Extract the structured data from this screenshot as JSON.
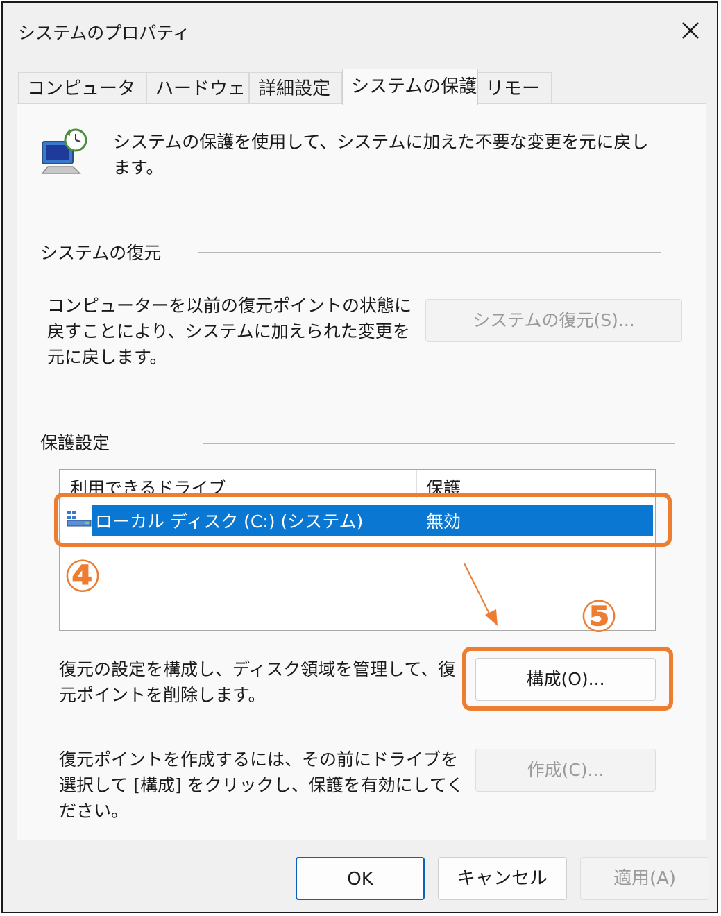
{
  "window": {
    "title": "システムのプロパティ"
  },
  "tabs": [
    {
      "label": "コンピューター名"
    },
    {
      "label": "ハードウェア"
    },
    {
      "label": "詳細設定"
    },
    {
      "label": "システムの保護"
    },
    {
      "label": "リモート"
    }
  ],
  "intro": {
    "text": "システムの保護を使用して、システムに加えた不要な変更を元に戻します。"
  },
  "restore": {
    "group_title": "システムの復元",
    "description": "コンピューターを以前の復元ポイントの状態に戻すことにより、システムに加えられた変更を元に戻します。",
    "button_label": "システムの復元(S)..."
  },
  "protection": {
    "group_title": "保護設定",
    "columns": [
      "利用できるドライブ",
      "保護"
    ],
    "drives": [
      {
        "name": "ローカル ディスク (C:) (システム)",
        "status": "無効"
      }
    ],
    "configure_description": "復元の設定を構成し、ディスク領域を管理して、復元ポイントを削除します。",
    "configure_button": "構成(O)...",
    "create_description": "復元ポイントを作成するには、その前にドライブを選択して [構成] をクリックし、保護を有効にしてください。",
    "create_button": "作成(C)..."
  },
  "annotations": {
    "marker_drive": "④",
    "marker_configure": "⑤",
    "color": "#ed7d31"
  },
  "footer": {
    "ok": "OK",
    "cancel": "キャンセル",
    "apply": "適用(A)"
  },
  "colors": {
    "selection": "#0a78d2",
    "accent": "#0a63b5"
  }
}
